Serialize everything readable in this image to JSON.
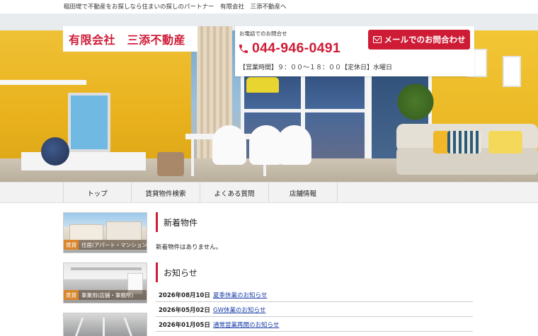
{
  "header": {
    "tagline": "稲田堤で不動産をお探しなら住まいの探しのパートナー　有限会社　三添不動産へ",
    "logo_text": "有限会社　三添不動産"
  },
  "contact": {
    "label": "お電話でのお問合せ",
    "phone_icon": "phone-icon",
    "phone": "044-946-0491",
    "hours": "【営業時間】９：００～１８：００【定休日】水曜日",
    "mail_button_label": "メールでのお問合わせ",
    "mail_icon": "envelope-icon",
    "accent_color": "#cf1c36"
  },
  "nav": {
    "items": [
      {
        "label": "トップ"
      },
      {
        "label": "賃貸物件検索"
      },
      {
        "label": "よくある質問"
      },
      {
        "label": "店舗情報"
      }
    ]
  },
  "sidebar": {
    "banners": [
      {
        "tag": "賃貸",
        "label": "住居(アパート・マンション・戸建)"
      },
      {
        "tag": "賃貸",
        "label": "事業用(店舗・事務所)"
      },
      {
        "tag": "",
        "label": ""
      }
    ]
  },
  "main": {
    "new_listings": {
      "title": "新着物件",
      "empty_text": "新着物件はありません。"
    },
    "news": {
      "title": "お知らせ",
      "items": [
        {
          "date": "2026年08月10日",
          "title": "夏季休業のお知らせ"
        },
        {
          "date": "2026年05月02日",
          "title": "GW休業のお知らせ"
        },
        {
          "date": "2026年01月05日",
          "title": "通常営業再開のお知らせ"
        }
      ]
    }
  }
}
